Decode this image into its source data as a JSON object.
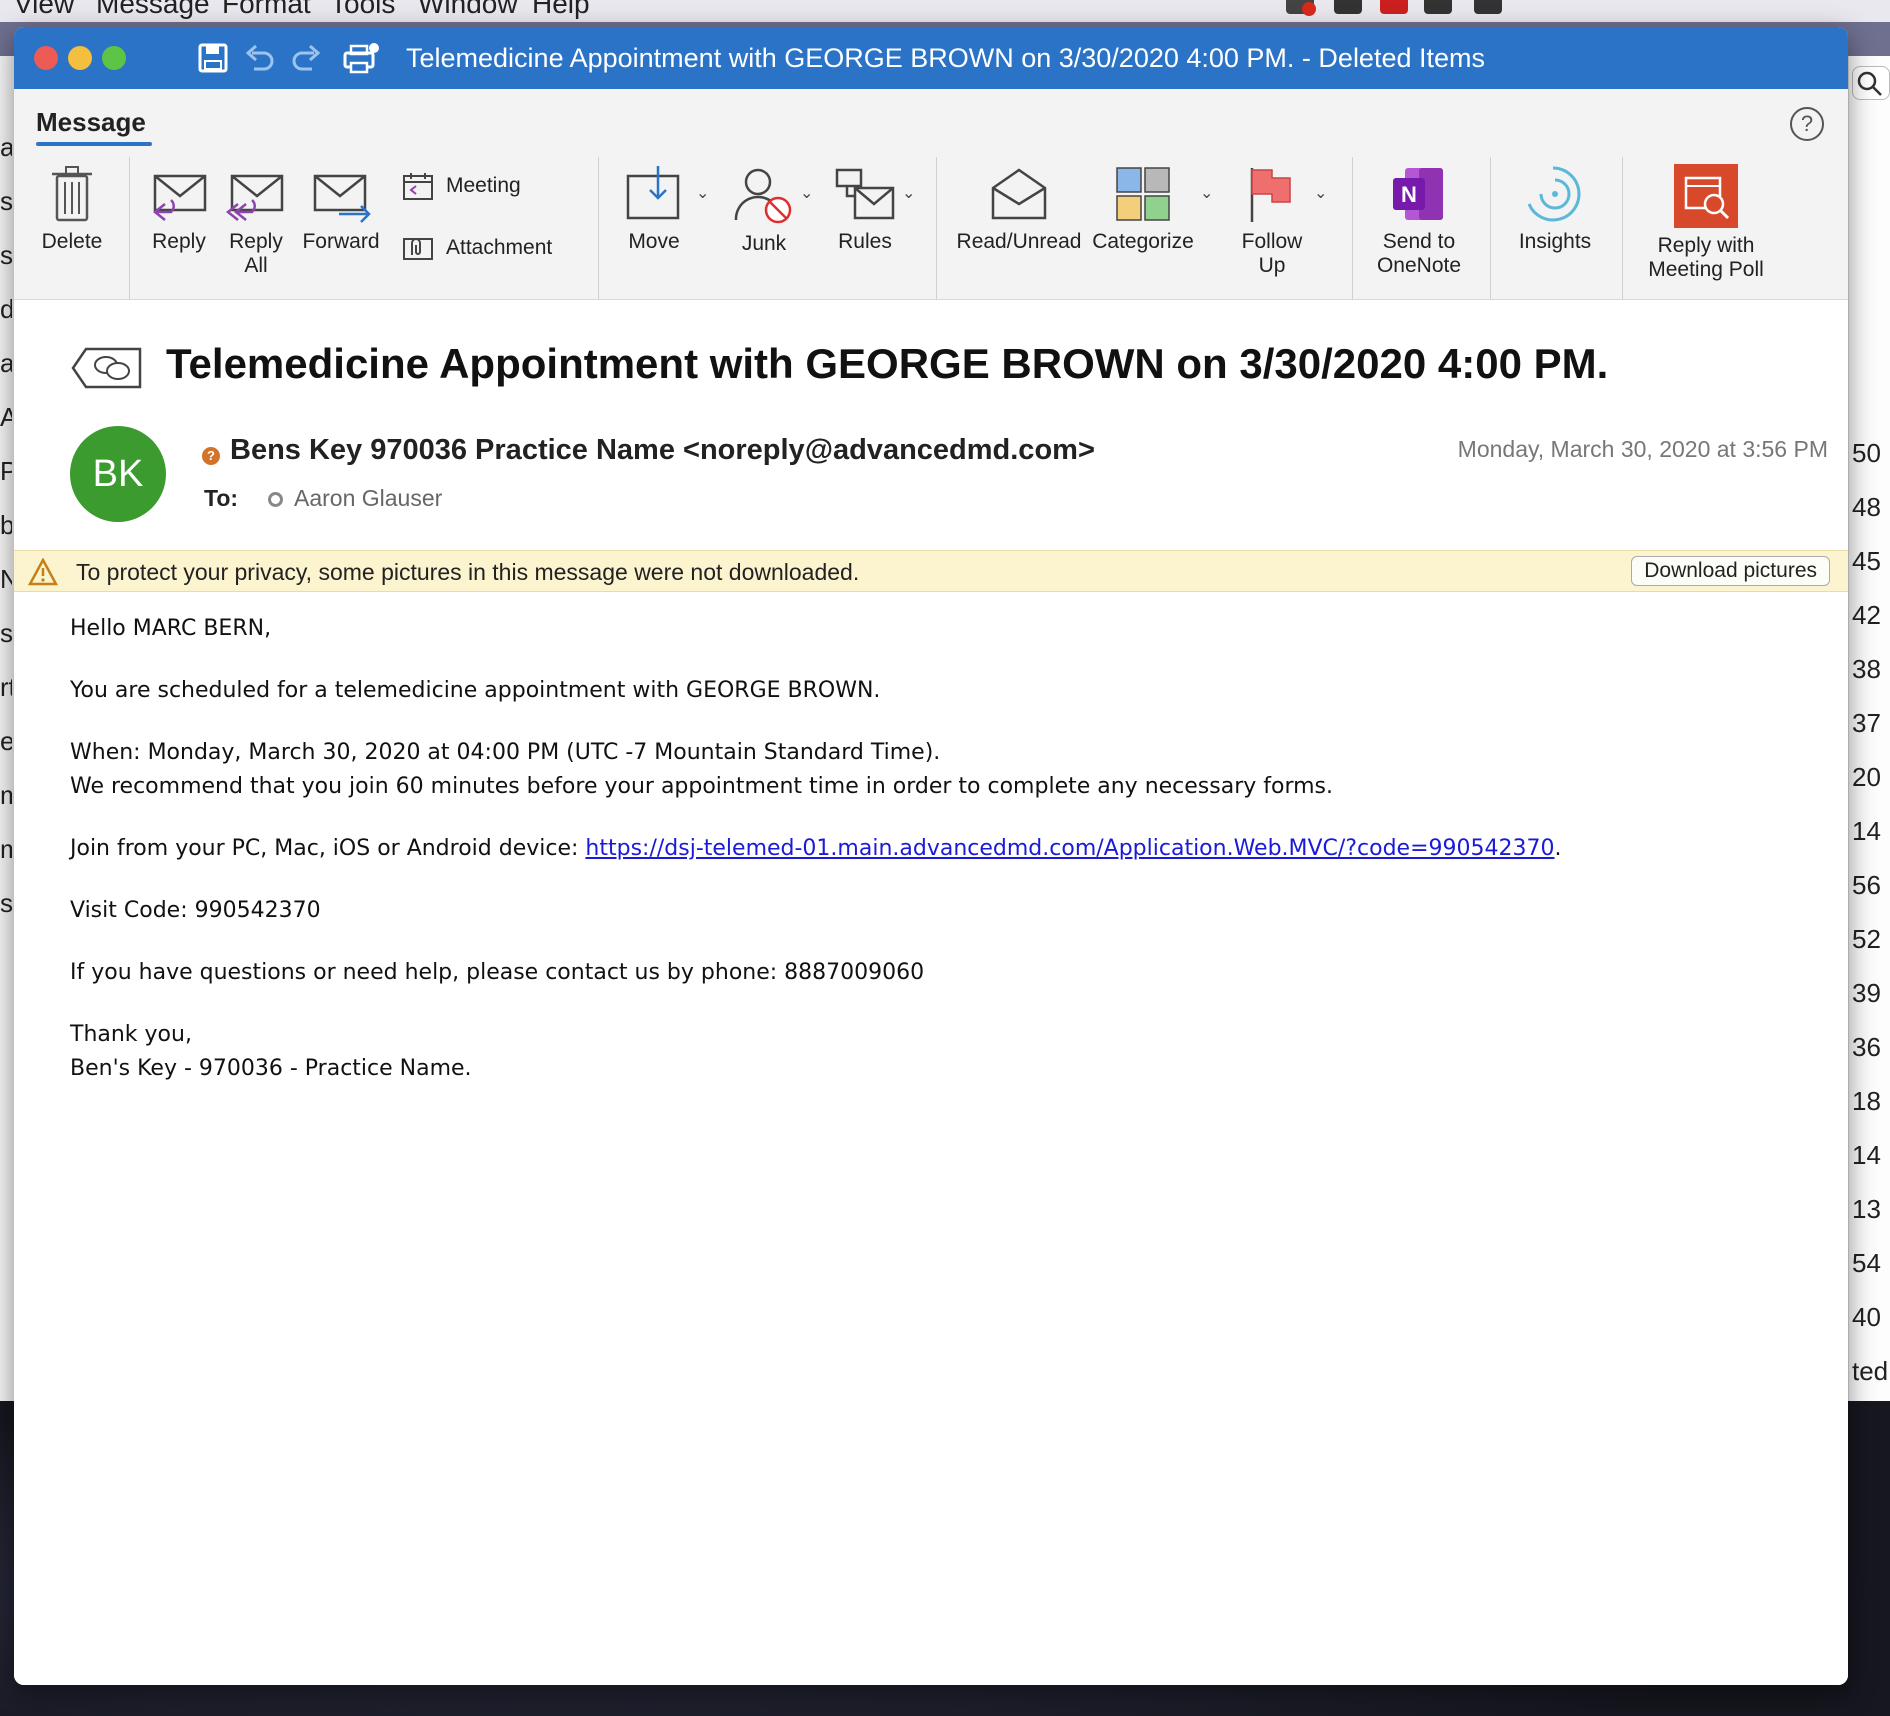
{
  "menubar": {
    "items": [
      "View",
      "Message",
      "Format",
      "Tools",
      "Window",
      "Help"
    ]
  },
  "window": {
    "title": "Telemedicine Appointment with GEORGE BROWN on 3/30/2020 4:00 PM. - Deleted Items"
  },
  "ribbon": {
    "tab": "Message",
    "help": "?",
    "buttons": {
      "delete": "Delete",
      "reply": "Reply",
      "reply_all_1": "Reply",
      "reply_all_2": "All",
      "forward": "Forward",
      "meeting": "Meeting",
      "attachment": "Attachment",
      "move": "Move",
      "junk": "Junk",
      "rules": "Rules",
      "read_unread": "Read/Unread",
      "categorize": "Categorize",
      "follow_up_1": "Follow",
      "follow_up_2": "Up",
      "send_onenote_1": "Send to",
      "send_onenote_2": "OneNote",
      "insights": "Insights",
      "reply_poll_1": "Reply with",
      "reply_poll_2": "Meeting Poll"
    },
    "onenote_letter": "N"
  },
  "message": {
    "subject": "Telemedicine Appointment with GEORGE BROWN on 3/30/2020 4:00 PM.",
    "avatar_initials": "BK",
    "avatar_color": "#3c9b2f",
    "sender": "Bens Key 970036 Practice Name <noreply@advancedmd.com>",
    "date": "Monday, March 30, 2020 at 3:56 PM",
    "to_label": "To:",
    "to_name": "Aaron Glauser",
    "infobar_text": "To protect your privacy, some pictures in this message were not downloaded.",
    "download_button": "Download pictures",
    "body": {
      "greeting": "Hello MARC BERN,",
      "line1": "You are scheduled for a telemedicine appointment with GEORGE BROWN.",
      "when": "When: Monday, March 30, 2020 at 04:00 PM (UTC -7 Mountain Standard Time).",
      "recommend": "We recommend that you join 60 minutes before your appointment time in order to complete any necessary forms.",
      "join_prefix": "Join from your PC, Mac, iOS or Android device: ",
      "join_link": "https://dsj-telemed-01.main.advancedmd.com/Application.Web.MVC/?code=990542370",
      "join_suffix": ".",
      "visit_code": "Visit Code: 990542370",
      "questions": "If you have questions or need help, please contact us by phone: 8887009060",
      "thanks": "Thank you,",
      "signature": "Ben's Key - 970036 - Practice Name."
    }
  },
  "background_list": {
    "times": [
      "50",
      "48",
      "45",
      "42",
      "38",
      "37",
      "20",
      "14",
      "56",
      "52",
      "39",
      "36",
      "18",
      "14",
      "13",
      "54",
      "40",
      "ted"
    ],
    "left_letters": [
      "a",
      "s",
      "s",
      "d",
      "a",
      "A",
      "P",
      "b",
      "N",
      "s",
      "rt",
      "e",
      "m",
      "m",
      "s"
    ]
  }
}
